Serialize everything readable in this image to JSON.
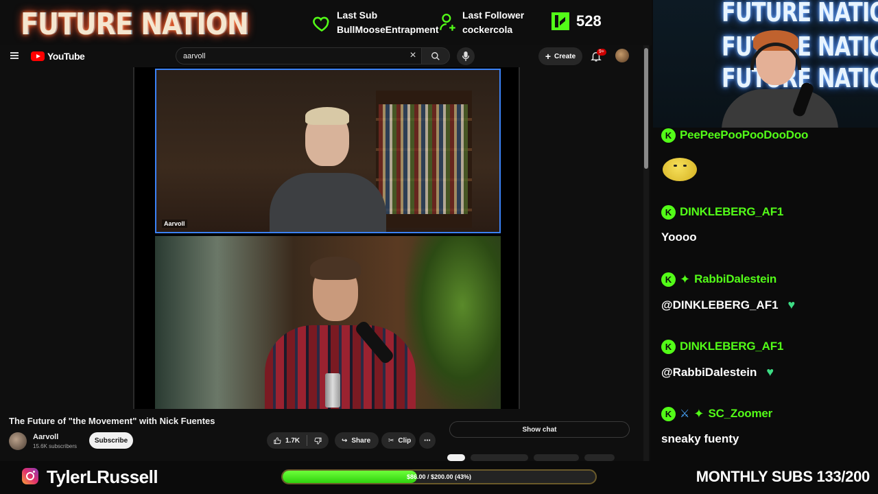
{
  "overlay": {
    "brand": "FUTURE NATION",
    "last_sub": {
      "label": "Last Sub",
      "value": "BullMooseEntrapment"
    },
    "last_follower": {
      "label": "Last Follower",
      "value": "cockercola"
    },
    "kick_viewers": "528"
  },
  "youtube": {
    "logo_text": "YouTube",
    "search_query": "aarvoll",
    "create_label": "Create",
    "notifications_badge": "9+",
    "cam_label": "Aarvoll",
    "video_title": "The Future of \"the Movement\" with Nick Fuentes",
    "channel_name": "Aarvoll",
    "channel_subs": "15.6K subscribers",
    "subscribe_label": "Subscribe",
    "likes": "1.7K",
    "share_label": "Share",
    "clip_label": "Clip",
    "show_chat_label": "Show chat"
  },
  "webcam": {
    "neon_text": "FUTURE NATION"
  },
  "chat": {
    "messages": [
      {
        "user": "PeePeePooPooDooDoo",
        "text": ""
      },
      {
        "user": "DINKLEBERG_AF1",
        "text": "Yoooo"
      },
      {
        "user": "RabbiDalestein",
        "text": "@DINKLEBERG_AF1"
      },
      {
        "user": "DINKLEBERG_AF1",
        "text": "@RabbiDalestein"
      },
      {
        "user": "SC_Zoomer",
        "text": "sneaky fuenty"
      }
    ]
  },
  "footer": {
    "instagram_handle": "TylerLRussell",
    "goal_text": "$86.00 / $200.00 (43%)",
    "goal_fraction": 0.43,
    "monthly_subs": "MONTHLY SUBS 133/200"
  },
  "colors": {
    "kick_green": "#53fc18",
    "heart_green": "#3ddc84",
    "yt_red": "#ff0000"
  }
}
